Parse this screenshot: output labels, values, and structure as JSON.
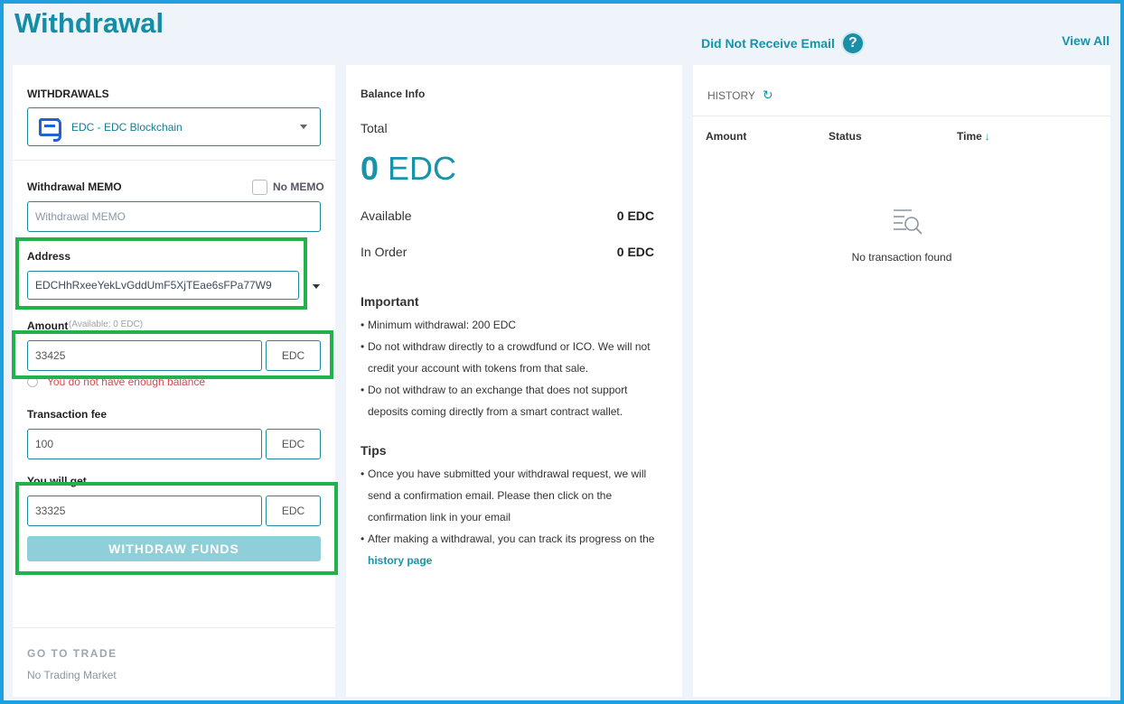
{
  "header": {
    "title": "Withdrawal",
    "did_not_receive": "Did Not Receive Email",
    "help_glyph": "?",
    "view_all": "View All"
  },
  "withdraw_form": {
    "section_label": "WITHDRAWALS",
    "selected_coin": "EDC - EDC Blockchain",
    "memo_label": "Withdrawal MEMO",
    "no_memo_label": "No MEMO",
    "memo_placeholder": "Withdrawal MEMO",
    "address_label": "Address",
    "address_value": "EDCHhRxeeYekLvGddUmF5XjTEae6sFPa77W9",
    "amount_label": "Amount",
    "available_hint": "(Available: 0 EDC)",
    "amount_value": "33425",
    "amount_unit": "EDC",
    "error_text": "You do not have enough balance",
    "fee_label": "Transaction fee",
    "fee_value": "100",
    "fee_unit": "EDC",
    "get_label": "You will get",
    "get_value": "33325",
    "get_unit": "EDC",
    "submit_label": "WITHDRAW FUNDS",
    "goto_trade": "GO TO TRADE",
    "no_trading": "No Trading Market"
  },
  "balance": {
    "title": "Balance Info",
    "total_label": "Total",
    "total_amount": "0",
    "total_unit": "EDC",
    "available_label": "Available",
    "available_value": "0 EDC",
    "in_order_label": "In Order",
    "in_order_value": "0 EDC",
    "important_title": "Important",
    "important": [
      "Minimum withdrawal: 200 EDC",
      "Do not withdraw directly to a crowdfund or ICO. We will not credit your account with tokens from that sale.",
      "Do not withdraw to an exchange that does not support deposits coming directly from a smart contract wallet."
    ],
    "tips_title": "Tips",
    "tips": [
      "Once you have submitted your withdrawal request, we will send a confirmation email. Please then click on the confirmation link in your email",
      "After making a withdrawal, you can track its progress on the"
    ],
    "tips_link": "history page"
  },
  "history": {
    "title": "HISTORY",
    "columns": [
      "Amount",
      "Status",
      "Time"
    ],
    "empty_text": "No transaction found"
  },
  "colors": {
    "accent": "#1893a9",
    "highlight": "#22b24c",
    "frame": "#1ea0e0",
    "button": "#8ecfd9",
    "error": "#d94b4b"
  }
}
